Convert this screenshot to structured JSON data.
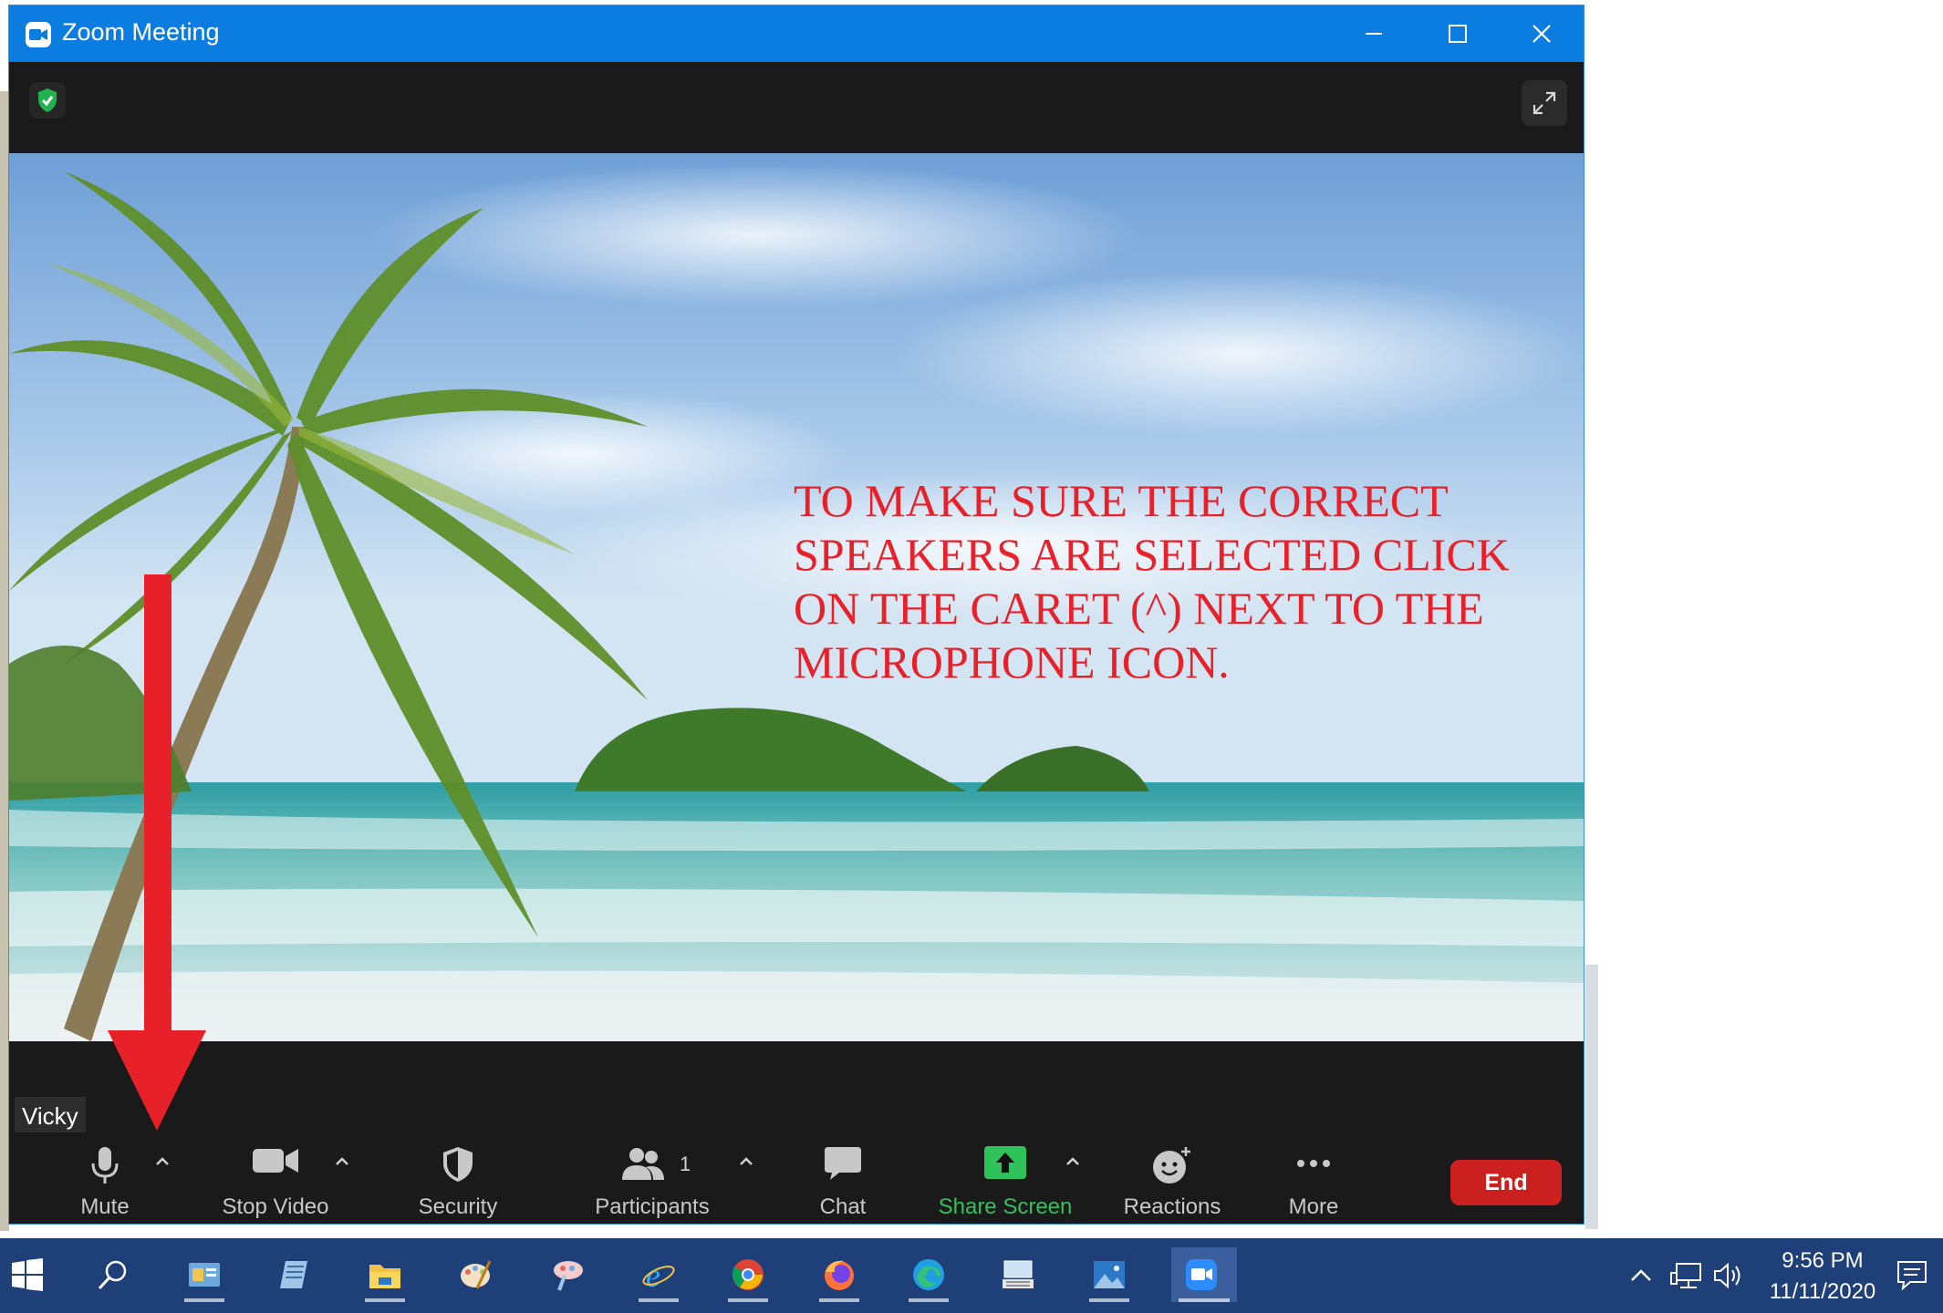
{
  "window": {
    "title": "Zoom Meeting",
    "controls": {
      "minimize": "minimize",
      "maximize": "maximize",
      "close": "close"
    }
  },
  "meeting": {
    "participant_name": "Vicky",
    "overlay_text": "TO MAKE SURE THE CORRECT\nSPEAKERS ARE SELECTED CLICK\nON THE CARET (^) NEXT TO THE\nMICROPHONE ICON."
  },
  "toolbar": {
    "mute_label": "Mute",
    "stop_video_label": "Stop Video",
    "security_label": "Security",
    "participants_label": "Participants",
    "participants_count": "1",
    "chat_label": "Chat",
    "share_screen_label": "Share Screen",
    "reactions_label": "Reactions",
    "more_label": "More",
    "end_label": "End"
  },
  "taskbar": {
    "time": "9:56 PM",
    "date": "11/11/2020",
    "apps": [
      "start",
      "search",
      "control-panel",
      "notepad",
      "file-explorer",
      "paint",
      "paint-3d",
      "internet-explorer",
      "chrome",
      "firefox",
      "edge",
      "on-screen-keyboard",
      "photos",
      "zoom"
    ]
  },
  "colors": {
    "titlebar": "#0b7de0",
    "end_button": "#cc2020",
    "share_green": "#2fc25b",
    "overlay_text": "#e8202a",
    "taskbar": "#1e3f78"
  }
}
